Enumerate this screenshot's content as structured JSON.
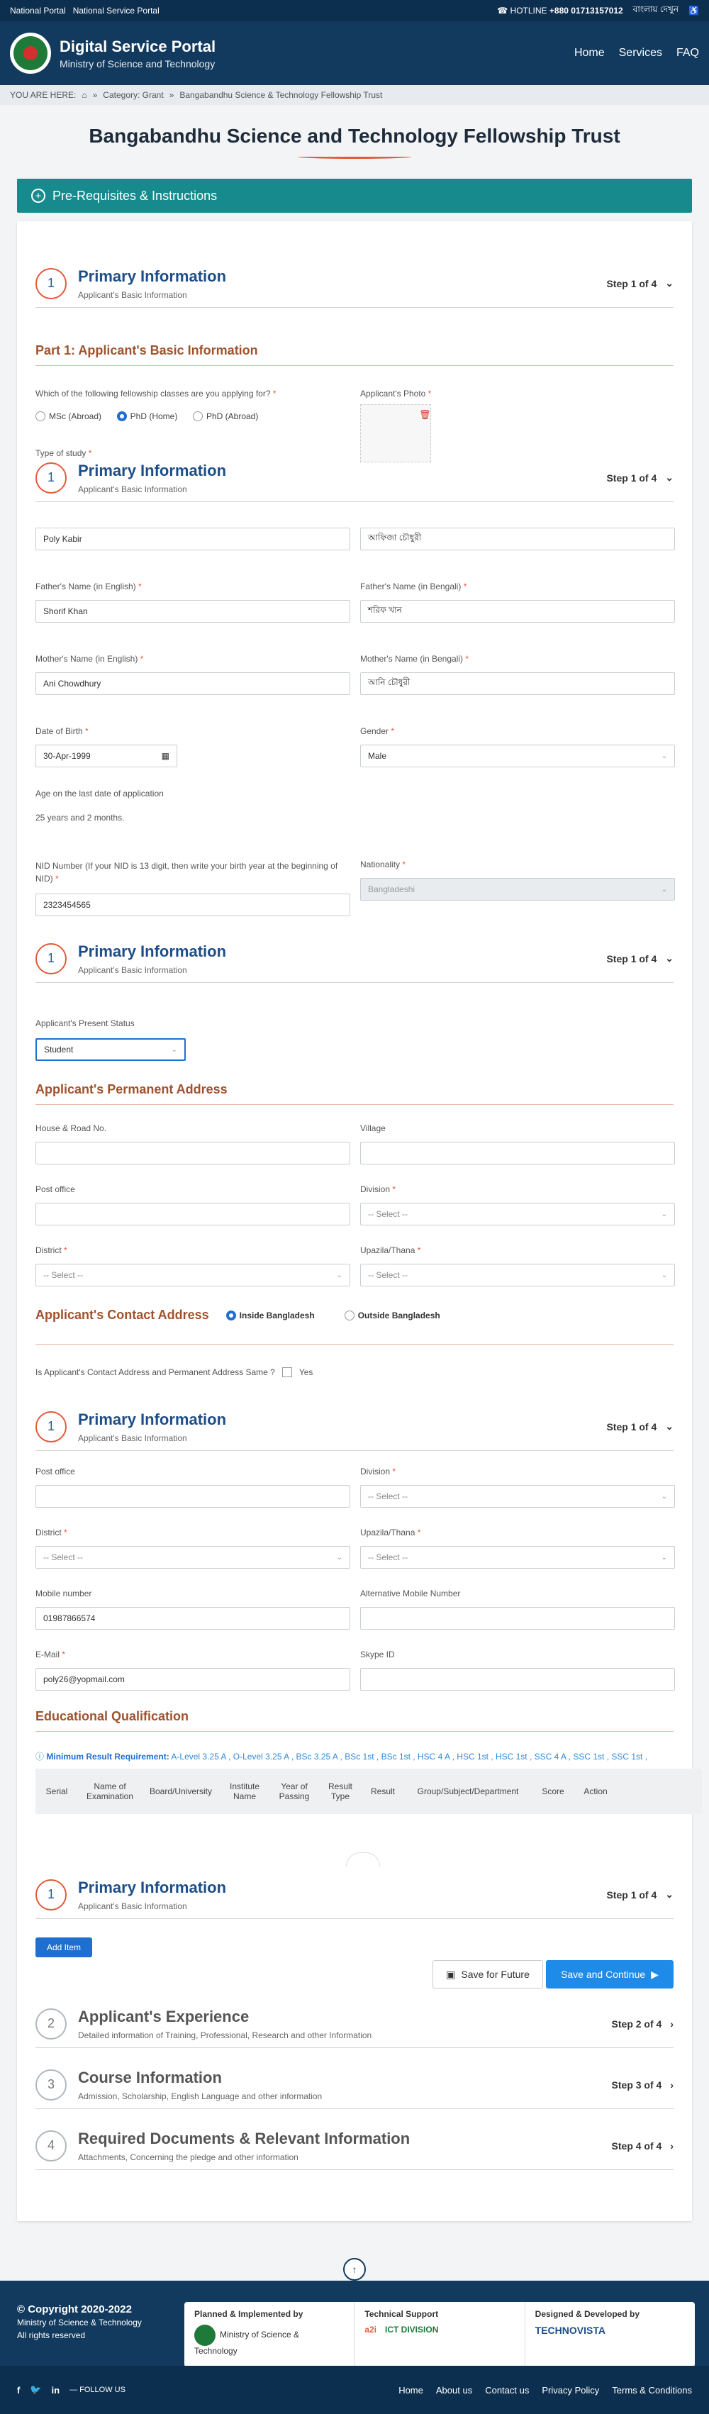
{
  "topbar": {
    "link1": "National Portal",
    "link2": "National Service Portal",
    "hotline_label": "HOTLINE",
    "hotline_number": "+880 01713157012",
    "lang": "বাংলায় দেখুন"
  },
  "header": {
    "title": "Digital Service Portal",
    "subtitle": "Ministry of Science and Technology",
    "nav": [
      "Home",
      "Services",
      "FAQ"
    ]
  },
  "breadcrumb": {
    "prefix": "YOU ARE HERE:",
    "cat": "Category: Grant",
    "current": "Bangabandhu Science & Technology Fellowship Trust"
  },
  "page_title": "Bangabandhu Science and Technology Fellowship Trust",
  "prereq": "Pre-Requisites & Instructions",
  "step1": {
    "num": "1",
    "title": "Primary Information",
    "sub": "Applicant's Basic Information",
    "step": "Step 1 of 4"
  },
  "part1": "Part 1: Applicant's Basic Information",
  "fellowship": {
    "q": "Which of the following fellowship classes are you applying for?",
    "options": [
      "MSc (Abroad)",
      "PhD (Home)",
      "PhD (Abroad)"
    ]
  },
  "photo_label": "Applicant's Photo",
  "type_of_study": "Type of study",
  "name_en": "Poly Kabir",
  "name_bn": "আফিজা চৌধুরী",
  "father_en_label": "Father's Name (in English)",
  "father_en": "Shorif Khan",
  "father_bn_label": "Father's Name (in Bengali)",
  "father_bn": "শরিফ খান",
  "mother_en_label": "Mother's Name (in English)",
  "mother_en": "Ani Chowdhury",
  "mother_bn_label": "Mother's Name (in Bengali)",
  "mother_bn": "আনি চৌধুরী",
  "dob_label": "Date of Birth",
  "dob": "30-Apr-1999",
  "gender_label": "Gender",
  "gender": "Male",
  "age_label": "Age on the last date of application",
  "age": "25 years and 2 months.",
  "nid_label": "NID Number (If your NID is 13 digit, then write your birth year at the beginning of NID)",
  "nid": "2323454565",
  "nationality_label": "Nationality",
  "nationality": "Bangladeshi",
  "present_status_label": "Applicant's Present Status",
  "present_status": "Student",
  "perm_addr": "Applicant's Permanent Address",
  "house_label": "House & Road No.",
  "village_label": "Village",
  "post_label": "Post office",
  "division_label": "Division",
  "district_label": "District",
  "upazila_label": "Upazila/Thana",
  "select_ph": "-- Select --",
  "contact_addr": "Applicant's Contact Address",
  "inside": "Inside Bangladesh",
  "outside": "Outside Bangladesh",
  "same_q": "Is Applicant's Contact Address and Permanent Address Same ?",
  "yes": "Yes",
  "mobile_label": "Mobile number",
  "mobile": "01987866574",
  "alt_mobile_label": "Alternative Mobile Number",
  "email_label": "E-Mail",
  "email": "poly26@yopmail.com",
  "skype_label": "Skype ID",
  "edu": "Educational Qualification",
  "min_req_label": "Minimum Result Requirement:",
  "min_req": "A-Level 3.25 A , O-Level 3.25 A , BSc 3.25 A , BSc 1st , BSc 1st , HSC 4 A , HSC 1st , HSC 1st , SSC 4 A , SSC 1st , SSC 1st ,",
  "table_headers": [
    "Serial",
    "Name of Examination",
    "Board/University",
    "Institute Name",
    "Year of Passing",
    "Result Type",
    "Result",
    "Group/Subject/Department",
    "Score",
    "Action"
  ],
  "add_item": "Add Item",
  "save_future": "Save for Future",
  "save_continue": "Save and Continue",
  "steps": [
    {
      "num": "2",
      "title": "Applicant's Experience",
      "sub": "Detailed information of Training, Professional, Research and other Information",
      "step": "Step 2 of 4"
    },
    {
      "num": "3",
      "title": "Course Information",
      "sub": "Admission, Scholarship, English Language and other information",
      "step": "Step 3 of 4"
    },
    {
      "num": "4",
      "title": "Required Documents & Relevant Information",
      "sub": "Attachments, Concerning the pledge and other information",
      "step": "Step 4 of 4"
    }
  ],
  "footer": {
    "copyright": "© Copyright 2020-2022",
    "ministry": "Ministry of Science & Technology",
    "rights": "All rights reserved",
    "planned": "Planned & Implemented by",
    "planned_org": "Ministry of Science & Technology",
    "support": "Technical Support",
    "support_org": "ICT DIVISION",
    "designed": "Designed & Developed by",
    "designed_org": "TECHNOVISTA",
    "follow": "FOLLOW US",
    "links": [
      "Home",
      "About us",
      "Contact us",
      "Privacy Policy",
      "Terms & Conditions"
    ]
  },
  "colors": {
    "navy": "#123a5e",
    "teal": "#168a8d",
    "accent": "#e35a3c",
    "primary": "#1f6fd1"
  }
}
